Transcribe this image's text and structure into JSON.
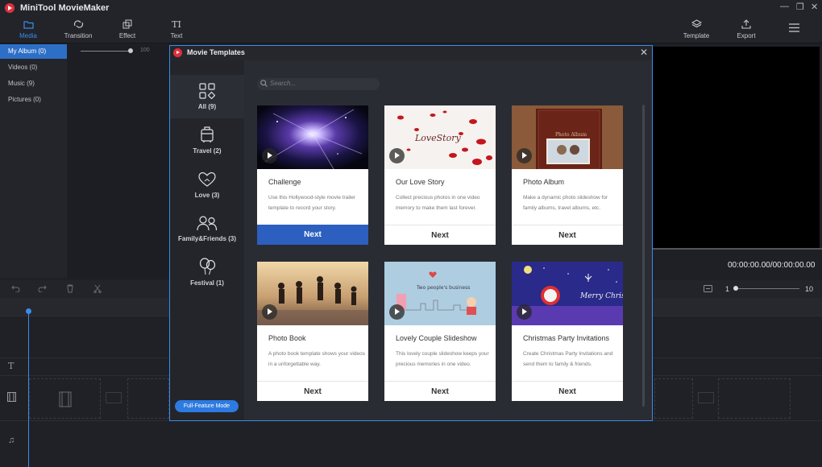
{
  "app": {
    "title": "MiniTool MovieMaker",
    "window_controls": [
      "—",
      "❐",
      "✕"
    ]
  },
  "toolbar": {
    "media": "Media",
    "transition": "Transition",
    "effect": "Effect",
    "text": "Text",
    "template": "Template",
    "export": "Export",
    "text_icon_glyph": "TI"
  },
  "album": {
    "items": [
      {
        "label": "My Album  (0)"
      },
      {
        "label": "Videos  (0)"
      },
      {
        "label": "Music  (9)"
      },
      {
        "label": "Pictures  (0)"
      }
    ],
    "slider_value": "100"
  },
  "preview": {
    "timecode": "00:00:00.00/00:00:00.00"
  },
  "timeline": {
    "zoom_min": "1",
    "zoom_max": "10"
  },
  "modal": {
    "title": "Movie Templates",
    "close": "✕",
    "search_placeholder": "Search...",
    "full_feature_button": "Full-Feature Mode",
    "categories": [
      {
        "label": "All",
        "count": "(9)",
        "icon": "grid-icon"
      },
      {
        "label": "Travel",
        "count": "(2)",
        "icon": "suitcase-icon"
      },
      {
        "label": "Love",
        "count": "(3)",
        "icon": "hearts-icon"
      },
      {
        "label": "Family&Friends",
        "count": "(3)",
        "icon": "people-icon"
      },
      {
        "label": "Festival",
        "count": "(1)",
        "icon": "balloons-icon"
      }
    ],
    "templates": [
      {
        "title": "Challenge",
        "desc": "Use this Hollywood-style movie trailer template to record your story.",
        "button": "Next",
        "thumb_text": ""
      },
      {
        "title": "Our Love Story",
        "desc": "Collect precious photos in one video memory to make them last forever.",
        "button": "Next",
        "thumb_text": "LoveStory"
      },
      {
        "title": "Photo Album",
        "desc": "Make a dynamic photo slideshow for family albums, travel albums, etc.",
        "button": "Next",
        "thumb_text": "Photo Album"
      },
      {
        "title": "Photo Book",
        "desc": "A photo book template shows your videos in a unforgettable way.",
        "button": "Next",
        "thumb_text": ""
      },
      {
        "title": "Lovely Couple Slideshow",
        "desc": "This lovely couple slideshow keeps your precious memories in one video.",
        "button": "Next",
        "thumb_text": "Two people's business"
      },
      {
        "title": "Christmas Party Invitations",
        "desc": "Create Christmas Party Invitations and send them to family & friends.",
        "button": "Next",
        "thumb_text": "Merry Christmas"
      }
    ]
  },
  "colors": {
    "accent": "#3b8be8",
    "primary_button": "#2c5fbf",
    "background": "#1e2026"
  }
}
